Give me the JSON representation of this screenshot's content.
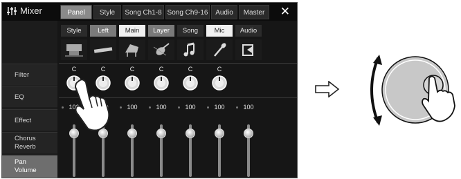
{
  "header": {
    "title": "Mixer",
    "tabs": [
      {
        "label": "Panel",
        "selected": true
      },
      {
        "label": "Style",
        "selected": false
      },
      {
        "label": "Song Ch1-8",
        "selected": false
      },
      {
        "label": "Song Ch9-16",
        "selected": false
      },
      {
        "label": "Audio",
        "selected": false
      },
      {
        "label": "Master",
        "selected": false
      }
    ],
    "close_icon": "close-icon"
  },
  "sidebar": {
    "items": [
      {
        "label": "Filter",
        "selected": false
      },
      {
        "label": "EQ",
        "selected": false
      },
      {
        "label": "Effect",
        "selected": false
      },
      {
        "label": "Chorus\nReverb",
        "selected": false
      },
      {
        "label": "Pan\nVolume",
        "selected": true
      }
    ]
  },
  "channels": [
    {
      "part": "Style",
      "style": "dark",
      "icon": "style-icon",
      "pan": "C",
      "volume": "100"
    },
    {
      "part": "Left",
      "style": "mid",
      "icon": "left-keyboard-icon",
      "pan": "C",
      "volume": "100"
    },
    {
      "part": "Main",
      "style": "light",
      "icon": "main-piano-icon",
      "pan": "C",
      "volume": "100"
    },
    {
      "part": "Layer",
      "style": "mid",
      "icon": "layer-violin-icon",
      "pan": "C",
      "volume": "100"
    },
    {
      "part": "Song",
      "style": "dark",
      "icon": "music-note-icon",
      "pan": "C",
      "volume": "100"
    },
    {
      "part": "Mic",
      "style": "light",
      "icon": "microphone-icon",
      "pan": "C",
      "volume": "100"
    },
    {
      "part": "Audio",
      "style": "dark",
      "icon": "audio-icon",
      "pan": "",
      "volume": "100"
    }
  ],
  "colors": {
    "screen_bg": "#161616",
    "selected_tab": "#8a8a8a",
    "selected_side": "#6e6e6e"
  }
}
